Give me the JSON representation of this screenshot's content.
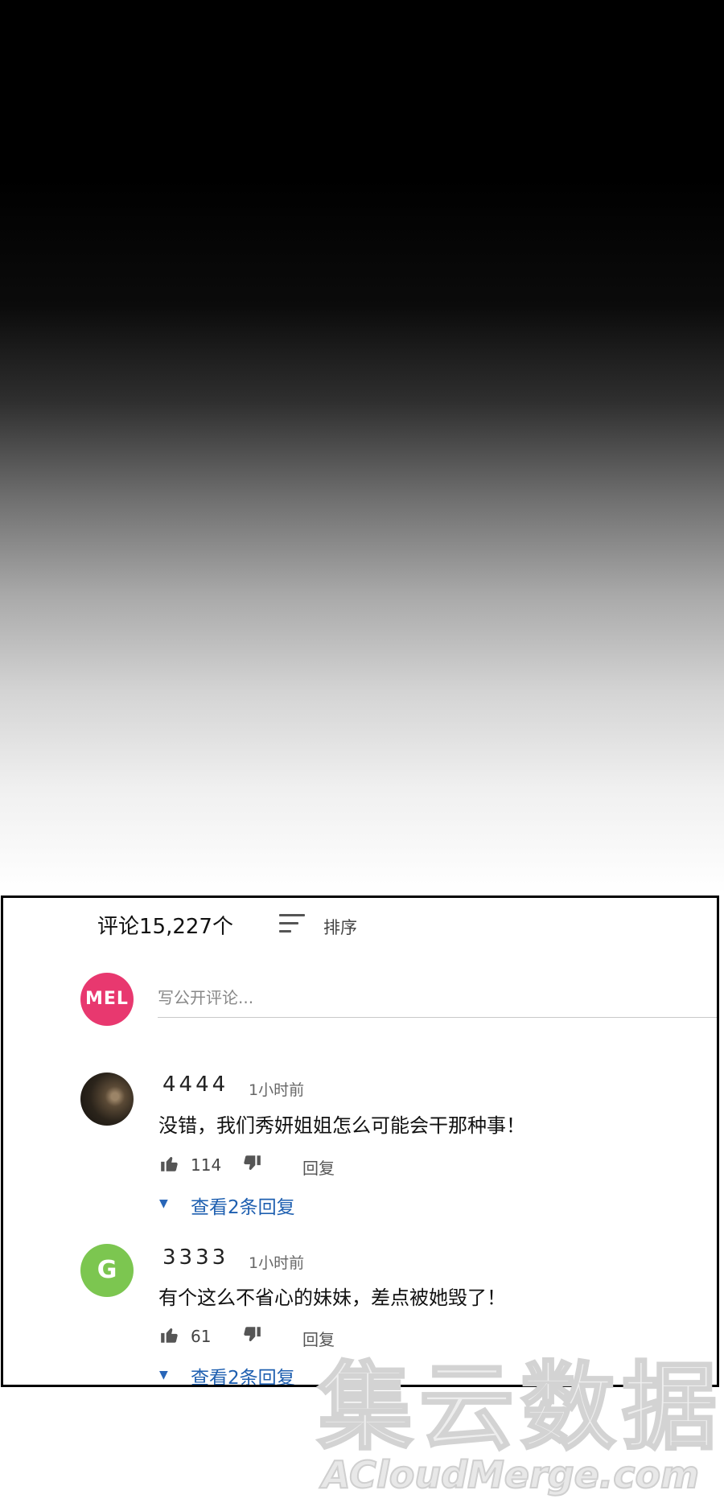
{
  "header": {
    "comment_count_label": "评论15,227个",
    "sort_label": "排序"
  },
  "composer": {
    "avatar_text": "MEL",
    "placeholder": "写公开评论..."
  },
  "comments": [
    {
      "author": "4444",
      "time": "1小时前",
      "text": "没错，我们秀妍姐姐怎么可能会干那种事！",
      "likes": "114",
      "reply_label": "回复",
      "view_replies": "查看2条回复"
    },
    {
      "author": "3333",
      "avatar_text": "G",
      "time": "1小时前",
      "text": "有个这么不省心的妹妹，差点被她毁了！",
      "likes": "61",
      "reply_label": "回复",
      "view_replies": "查看2条回复"
    }
  ],
  "watermark": {
    "cn": "集云数据",
    "en": "ACloudMerge.com"
  },
  "colors": {
    "link_blue": "#1e5fb0",
    "mel_avatar": "#e8386f",
    "g_avatar": "#7cc650"
  },
  "icons": [
    "sort-icon",
    "thumbs-up-icon",
    "thumbs-down-icon",
    "caret-down-icon"
  ]
}
